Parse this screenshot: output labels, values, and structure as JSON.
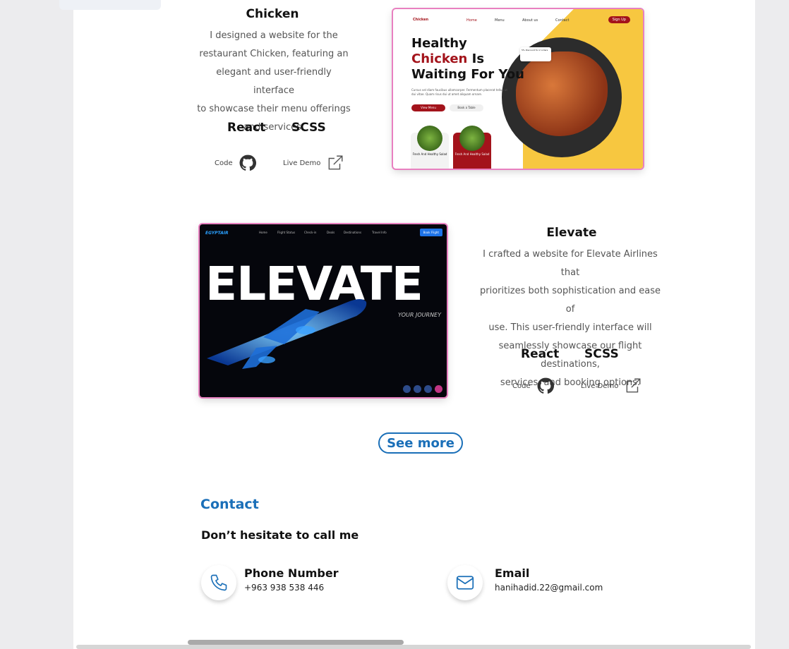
{
  "sidebar": {
    "partial_label": "..."
  },
  "projects": [
    {
      "title": "Chicken",
      "description": "I designed a website for the restaurant Chicken, featuring an elegant and user-friendly interface to showcase their menu offerings and services.",
      "description_lines": [
        "I designed a website for the",
        "restaurant Chicken, featuring an",
        "elegant and user-friendly interface",
        "to showcase their menu offerings",
        "and services."
      ],
      "tech": [
        "React",
        "SCSS"
      ],
      "code_label": "Code",
      "demo_label": "Live Demo",
      "preview": {
        "brand": "Chicken",
        "nav": [
          "Home",
          "Menu",
          "About us",
          "Contact"
        ],
        "signup": "Sign Up",
        "headline_1": "Healthy",
        "headline_2_red": "Chicken",
        "headline_2_rest": " Is",
        "headline_3": "Waiting For You",
        "body": "Cursus vel diam faucibus ullamcorper. Fermentum placerat tellus ut dui vitae. Quam risus dui ut amet aliquam ornare.",
        "btn_primary": "View Menu",
        "btn_secondary": "Book a Table",
        "card_1": "Fresh And Healthy Salad",
        "card_2": "Fresh And Healthy Salad",
        "discount": "5% Discount for 2 orders"
      }
    },
    {
      "title": "Elevate",
      "description": "I crafted a website for Elevate Airlines that prioritizes both sophistication and ease of use. This user-friendly interface will seamlessly showcase our flight destinations, services, and booking options.",
      "description_lines": [
        "I crafted a website for Elevate Airlines that",
        "prioritizes both sophistication and ease of",
        "use. This user-friendly interface will",
        "seamlessly showcase our flight destinations,",
        "services, and booking options."
      ],
      "tech": [
        "React",
        "SCSS"
      ],
      "code_label": "Code",
      "demo_label": "Live Demo",
      "preview": {
        "logo": "EGYPTAIR",
        "nav": [
          "Home",
          "Flight Status",
          "Check-in",
          "Deals",
          "Destinations",
          "Travel Info"
        ],
        "book": "Book Flight",
        "big_word": "ELEVATE",
        "tagline": "YOUR JOURNEY"
      }
    }
  ],
  "see_more": "See more",
  "contact": {
    "heading": "Contact",
    "subheading": "Don’t hesitate to call me",
    "phone_label": "Phone Number",
    "phone_value": "+963 938 538 446",
    "email_label": "Email",
    "email_value": "hanihadid.22@gmail.com"
  },
  "colors": {
    "accent": "#1a6fb8",
    "brand_red": "#a3131b",
    "yellow": "#f7c740"
  }
}
